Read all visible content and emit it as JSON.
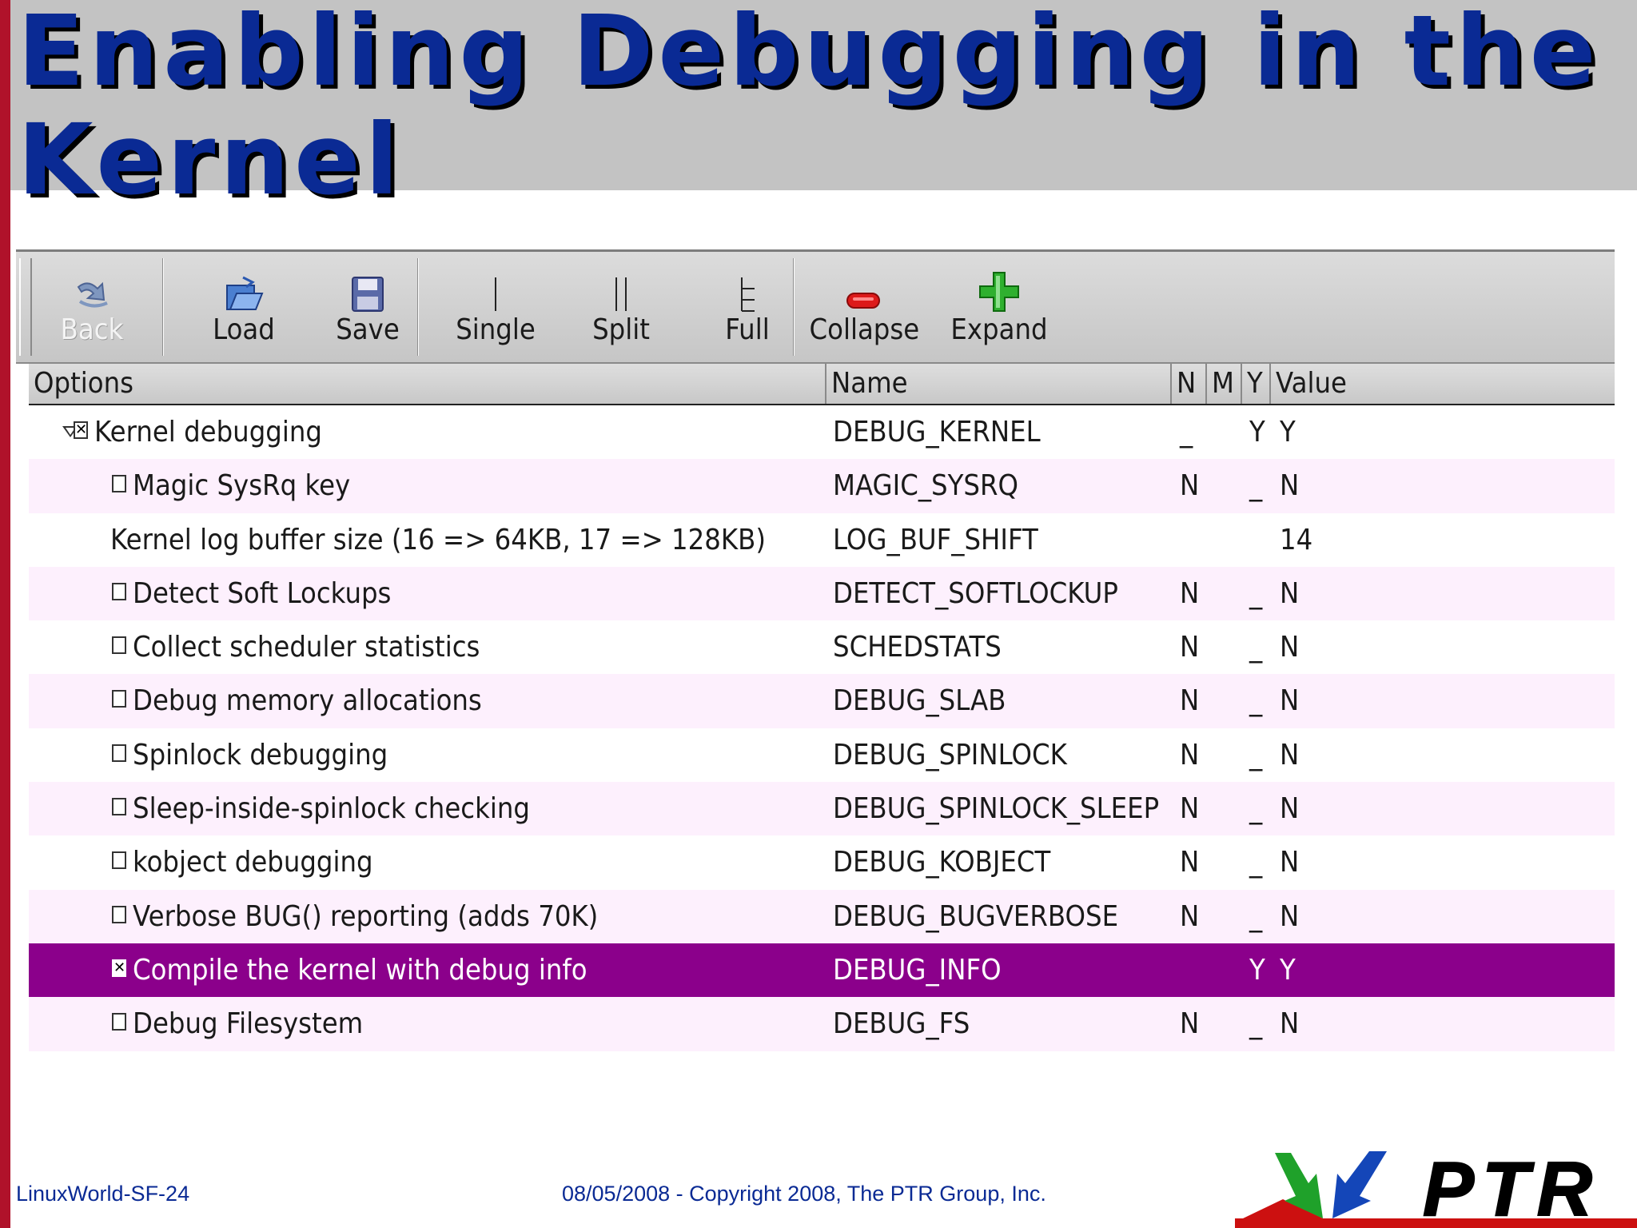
{
  "slide": {
    "title_line1": "Enabling Debugging in the",
    "title_line2": "Kernel",
    "footer_left": "LinuxWorld-SF-24",
    "footer_center": "08/05/2008 - Copyright 2008, The PTR Group, Inc.",
    "logo_text": "PTR"
  },
  "toolbar": {
    "buttons": [
      {
        "label": "Back",
        "icon": "back-arrow-icon",
        "disabled": true
      },
      {
        "label": "Load",
        "icon": "folder-open-icon"
      },
      {
        "label": "Save",
        "icon": "floppy-disk-icon"
      },
      {
        "label": "Single",
        "icon": "single-view-icon"
      },
      {
        "label": "Split",
        "icon": "split-view-icon"
      },
      {
        "label": "Full",
        "icon": "full-view-icon"
      },
      {
        "label": "Collapse",
        "icon": "minus-icon"
      },
      {
        "label": "Expand",
        "icon": "plus-icon"
      }
    ]
  },
  "table": {
    "columns": {
      "options": "Options",
      "name": "Name",
      "n": "N",
      "m": "M",
      "y": "Y",
      "value": "Value"
    },
    "rows": [
      {
        "option": "Kernel debugging",
        "name": "DEBUG_KERNEL",
        "n": "_",
        "m": "",
        "y": "Y",
        "value": "Y",
        "checked": true,
        "expanded": true,
        "level": 0
      },
      {
        "option": "Magic SysRq key",
        "name": "MAGIC_SYSRQ",
        "n": "N",
        "m": "",
        "y": "_",
        "value": "N",
        "checked": false,
        "level": 1
      },
      {
        "option": "Kernel log buffer size (16 => 64KB, 17 => 128KB)",
        "name": "LOG_BUF_SHIFT",
        "n": "",
        "m": "",
        "y": "",
        "value": "14",
        "checkbox": false,
        "level": 1
      },
      {
        "option": "Detect Soft Lockups",
        "name": "DETECT_SOFTLOCKUP",
        "n": "N",
        "m": "",
        "y": "_",
        "value": "N",
        "checked": false,
        "level": 1
      },
      {
        "option": "Collect scheduler statistics",
        "name": "SCHEDSTATS",
        "n": "N",
        "m": "",
        "y": "_",
        "value": "N",
        "checked": false,
        "level": 1
      },
      {
        "option": "Debug memory allocations",
        "name": "DEBUG_SLAB",
        "n": "N",
        "m": "",
        "y": "_",
        "value": "N",
        "checked": false,
        "level": 1
      },
      {
        "option": "Spinlock debugging",
        "name": "DEBUG_SPINLOCK",
        "n": "N",
        "m": "",
        "y": "_",
        "value": "N",
        "checked": false,
        "level": 1
      },
      {
        "option": "Sleep-inside-spinlock checking",
        "name": "DEBUG_SPINLOCK_SLEEP",
        "n": "N",
        "m": "",
        "y": "_",
        "value": "N",
        "checked": false,
        "level": 1
      },
      {
        "option": "kobject debugging",
        "name": "DEBUG_KOBJECT",
        "n": "N",
        "m": "",
        "y": "_",
        "value": "N",
        "checked": false,
        "level": 1
      },
      {
        "option": "Verbose BUG() reporting (adds 70K)",
        "name": "DEBUG_BUGVERBOSE",
        "n": "N",
        "m": "",
        "y": "_",
        "value": "N",
        "checked": false,
        "level": 1
      },
      {
        "option": "Compile the kernel with debug info",
        "name": "DEBUG_INFO",
        "n": "",
        "m": "",
        "y": "Y",
        "value": "Y",
        "checked": true,
        "selected": true,
        "level": 1
      },
      {
        "option": "Debug Filesystem",
        "name": "DEBUG_FS",
        "n": "N",
        "m": "",
        "y": "_",
        "value": "N",
        "checked": false,
        "level": 1
      }
    ]
  },
  "colors": {
    "title": "#0a2a94",
    "left_bar": "#b0122a",
    "selected_row": "#8b008b",
    "alt_row": "#fdf0fd",
    "logo_red": "#cc1010",
    "logo_green": "#1fa12a",
    "logo_blue": "#1446b8"
  }
}
